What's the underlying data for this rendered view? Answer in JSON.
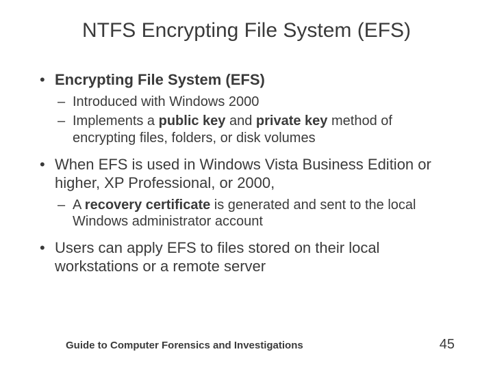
{
  "title": "NTFS Encrypting File System (EFS)",
  "bullets": {
    "b1_bold": "Encrypting File System (EFS)",
    "b1_sub1": "Introduced with Windows 2000",
    "b1_sub2_a": "Implements a ",
    "b1_sub2_b": "public key",
    "b1_sub2_c": " and ",
    "b1_sub2_d": "private key",
    "b1_sub2_e": " method of encrypting files, folders, or disk volumes",
    "b2": "When EFS is used in Windows Vista Business Edition or higher, XP Professional, or 2000,",
    "b2_sub1_a": "A ",
    "b2_sub1_b": "recovery certificate",
    "b2_sub1_c": " is generated and sent to the local Windows administrator account",
    "b3": "Users can apply EFS to files stored on their local workstations or a remote server"
  },
  "footer": {
    "text": "Guide to Computer Forensics and Investigations",
    "page": "45"
  }
}
